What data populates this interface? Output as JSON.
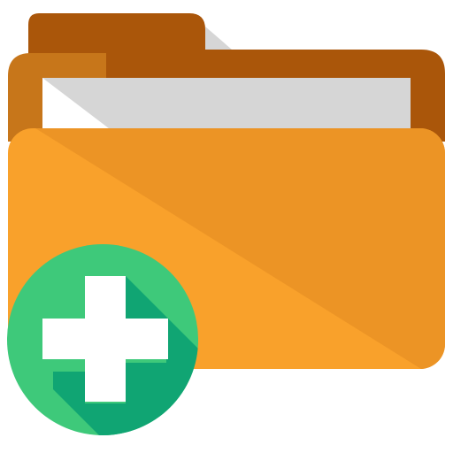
{
  "icon": {
    "name": "add-folder-icon",
    "colors": {
      "folder_back": "#AA560A",
      "folder_back_highlight": "#C7761A",
      "paper_light": "#FFFFFF",
      "paper_shade": "#D6D6D6",
      "folder_front": "#F9A12B",
      "folder_front_shade": "#EC9425",
      "badge": "#3EC97A",
      "badge_shadow": "#10A573",
      "plus": "#FFFFFF"
    }
  }
}
